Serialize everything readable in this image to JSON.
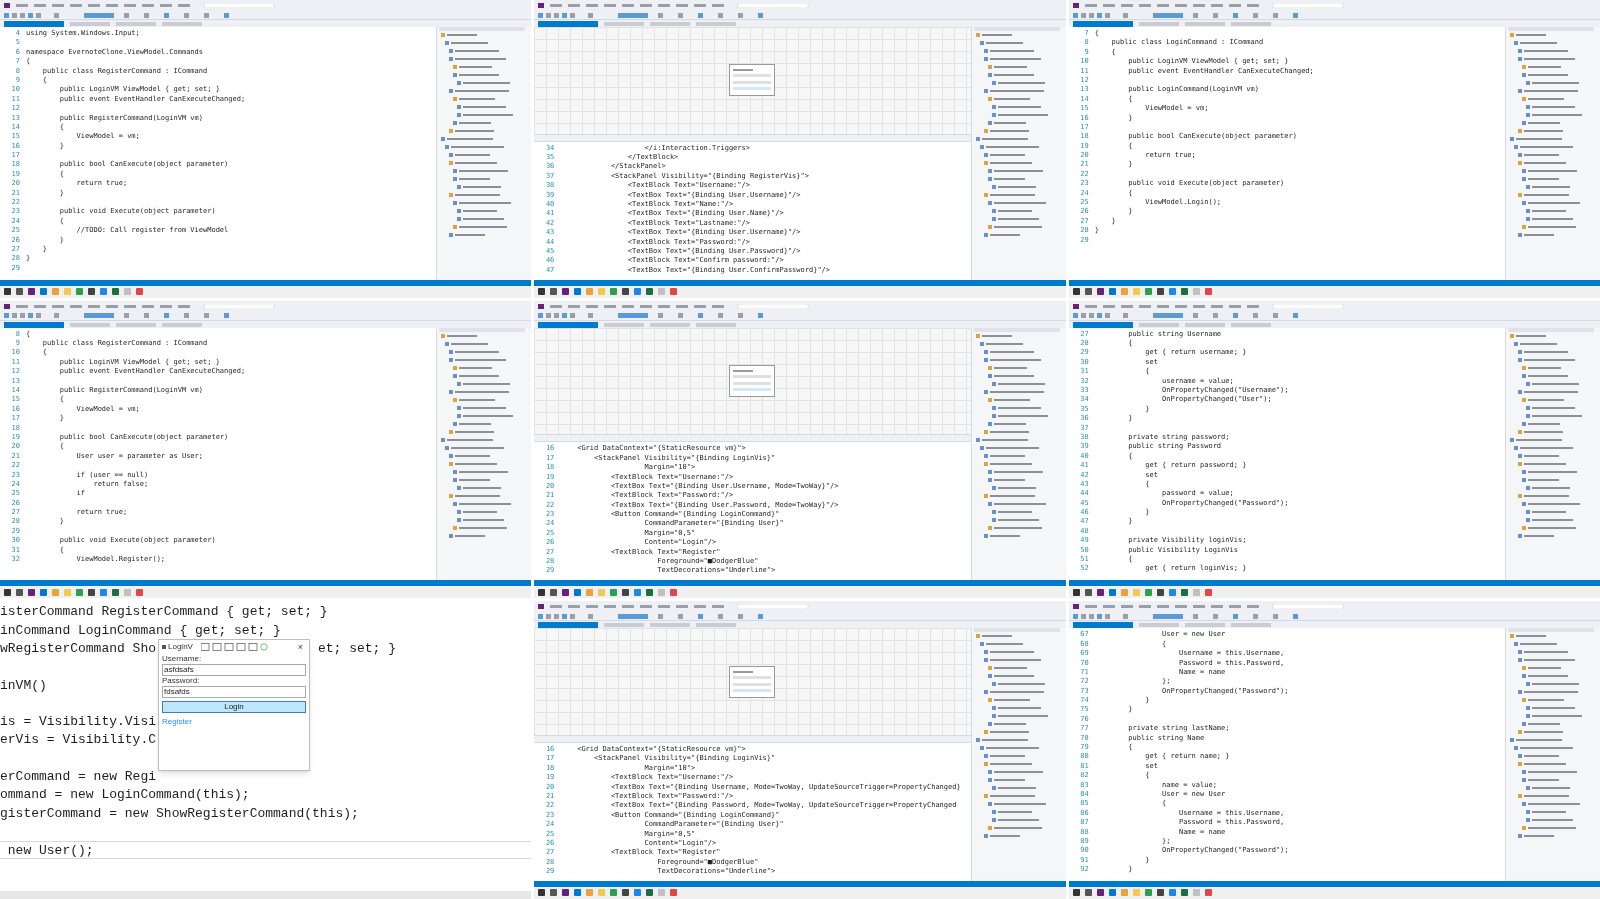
{
  "tiles": [
    {
      "kind": "code",
      "lines": [
        {
          "number": "4",
          "text": "using System.Windows.Input;"
        },
        {
          "number": "5"
        },
        {
          "number": "6",
          "text": "namespace EvernoteClone.ViewModel.Commands"
        },
        {
          "number": "7",
          "text": "{"
        },
        {
          "number": "8",
          "text": "    public class RegisterCommand : ICommand"
        },
        {
          "number": "9",
          "text": "    {"
        },
        {
          "number": "10",
          "text": "        public LoginVM ViewModel { get; set; }"
        },
        {
          "number": "11",
          "text": "        public event EventHandler CanExecuteChanged;"
        },
        {
          "number": "12"
        },
        {
          "number": "13",
          "text": "        public RegisterCommand(LoginVM vm)"
        },
        {
          "number": "14",
          "text": "        {"
        },
        {
          "number": "15",
          "text": "            ViewModel = vm;"
        },
        {
          "number": "16",
          "text": "        }"
        },
        {
          "number": "17"
        },
        {
          "number": "18",
          "text": "        public bool CanExecute(object parameter)"
        },
        {
          "number": "19",
          "text": "        {"
        },
        {
          "number": "20",
          "text": "            return true;"
        },
        {
          "number": "21",
          "text": "        }"
        },
        {
          "number": "22"
        },
        {
          "number": "23",
          "text": "        public void Execute(object parameter)"
        },
        {
          "number": "24",
          "text": "        {"
        },
        {
          "number": "25",
          "text": "            //TODO: Call register from ViewModel"
        },
        {
          "number": "26",
          "text": "        }"
        },
        {
          "number": "27",
          "text": "    }"
        },
        {
          "number": "28",
          "text": "}"
        },
        {
          "number": "29"
        }
      ]
    },
    {
      "kind": "xaml",
      "lines": [
        {
          "number": "34",
          "text": "                    </i:Interaction.Triggers>"
        },
        {
          "number": "35",
          "text": "                </TextBlock>"
        },
        {
          "number": "36",
          "text": "            </StackPanel>"
        },
        {
          "number": "37",
          "text": "            <StackPanel Visibility=\"{Binding RegisterVis}\">"
        },
        {
          "number": "38",
          "text": "                <TextBlock Text=\"Username:\"/>"
        },
        {
          "number": "39",
          "text": "                <TextBox Text=\"{Binding User.Username}\"/>"
        },
        {
          "number": "40",
          "text": "                <TextBlock Text=\"Name:\"/>"
        },
        {
          "number": "41",
          "text": "                <TextBox Text=\"{Binding User.Name}\"/>"
        },
        {
          "number": "42",
          "text": "                <TextBlock Text=\"Lastname:\"/>"
        },
        {
          "number": "43",
          "text": "                <TextBox Text=\"{Binding User.Username}\"/>"
        },
        {
          "number": "44",
          "text": "                <TextBlock Text=\"Password:\"/>"
        },
        {
          "number": "45",
          "text": "                <TextBox Text=\"{Binding User.Password}\"/>"
        },
        {
          "number": "46",
          "text": "                <TextBlock Text=\"Confirm password:\"/>"
        },
        {
          "number": "47",
          "text": "                <TextBox Text=\"{Binding User.ConfirmPassword}\"/>"
        }
      ]
    },
    {
      "kind": "code",
      "lines": [
        {
          "number": "7",
          "text": "{"
        },
        {
          "number": "8",
          "text": "    public class LoginCommand : ICommand"
        },
        {
          "number": "9",
          "text": "    {"
        },
        {
          "number": "10",
          "text": "        public LoginVM ViewModel { get; set; }"
        },
        {
          "number": "11",
          "text": "        public event EventHandler CanExecuteChanged;"
        },
        {
          "number": "12"
        },
        {
          "number": "13",
          "text": "        public LoginCommand(LoginVM vm)"
        },
        {
          "number": "14",
          "text": "        {"
        },
        {
          "number": "15",
          "text": "            ViewModel = vm;"
        },
        {
          "number": "16",
          "text": "        }"
        },
        {
          "number": "17"
        },
        {
          "number": "18",
          "text": "        public bool CanExecute(object parameter)"
        },
        {
          "number": "19",
          "text": "        {"
        },
        {
          "number": "20",
          "text": "            return true;"
        },
        {
          "number": "21",
          "text": "        }"
        },
        {
          "number": "22"
        },
        {
          "number": "23",
          "text": "        public void Execute(object parameter)"
        },
        {
          "number": "24",
          "text": "        {"
        },
        {
          "number": "25",
          "text": "            ViewModel.Login();"
        },
        {
          "number": "26",
          "text": "        }"
        },
        {
          "number": "27",
          "text": "    }"
        },
        {
          "number": "28",
          "text": "}"
        },
        {
          "number": "29"
        }
      ]
    },
    {
      "kind": "code",
      "lines": [
        {
          "number": "8",
          "text": "{"
        },
        {
          "number": "9",
          "text": "    public class RegisterCommand : ICommand"
        },
        {
          "number": "10",
          "text": "    {"
        },
        {
          "number": "11",
          "text": "        public LoginVM ViewModel { get; set; }"
        },
        {
          "number": "12",
          "text": "        public event EventHandler CanExecuteChanged;"
        },
        {
          "number": "13"
        },
        {
          "number": "14",
          "text": "        public RegisterCommand(LoginVM vm)"
        },
        {
          "number": "15",
          "text": "        {"
        },
        {
          "number": "16",
          "text": "            ViewModel = vm;"
        },
        {
          "number": "17",
          "text": "        }"
        },
        {
          "number": "18"
        },
        {
          "number": "19",
          "text": "        public bool CanExecute(object parameter)"
        },
        {
          "number": "20",
          "text": "        {"
        },
        {
          "number": "21",
          "text": "            User user = parameter as User;"
        },
        {
          "number": "22"
        },
        {
          "number": "23",
          "text": "            if (user == null)"
        },
        {
          "number": "24",
          "text": "                return false;"
        },
        {
          "number": "25",
          "text": "            if"
        },
        {
          "number": "26"
        },
        {
          "number": "27",
          "text": "            return true;"
        },
        {
          "number": "28",
          "text": "        }"
        },
        {
          "number": "29"
        },
        {
          "number": "30",
          "text": "        public void Execute(object parameter)"
        },
        {
          "number": "31",
          "text": "        {"
        },
        {
          "number": "32",
          "text": "            ViewModel.Register();"
        }
      ]
    },
    {
      "kind": "xaml",
      "lines": [
        {
          "number": "16",
          "text": "    <Grid DataContext=\"{StaticResource vm}\">"
        },
        {
          "number": "17",
          "text": "        <StackPanel Visibility=\"{Binding LoginVis}\""
        },
        {
          "number": "18",
          "text": "                    Margin=\"10\">"
        },
        {
          "number": "19",
          "text": "            <TextBlock Text=\"Username:\"/>"
        },
        {
          "number": "20",
          "text": "            <TextBox Text=\"{Binding User.Username, Mode=TwoWay}\"/>"
        },
        {
          "number": "21",
          "text": "            <TextBlock Text=\"Password:\"/>"
        },
        {
          "number": "22",
          "text": "            <TextBox Text=\"{Binding User.Password, Mode=TwoWay}\"/>"
        },
        {
          "number": "23",
          "text": "            <Button Command=\"{Binding LoginCommand}\""
        },
        {
          "number": "24",
          "text": "                    CommandParameter=\"{Binding User}\""
        },
        {
          "number": "25",
          "text": "                    Margin=\"0,5\""
        },
        {
          "number": "26",
          "text": "                    Content=\"Login\"/>"
        },
        {
          "number": "27",
          "text": "            <TextBlock Text=\"Register\""
        },
        {
          "number": "28",
          "text": "                       Foreground=\"■DodgerBlue\""
        },
        {
          "number": "29",
          "text": "                       TextDecorations=\"Underline\">"
        }
      ]
    },
    {
      "kind": "code",
      "lines": [
        {
          "number": "27",
          "text": "        public string Username"
        },
        {
          "number": "28",
          "text": "        {"
        },
        {
          "number": "29",
          "text": "            get { return username; }"
        },
        {
          "number": "30",
          "text": "            set"
        },
        {
          "number": "31",
          "text": "            {"
        },
        {
          "number": "32",
          "text": "                username = value;"
        },
        {
          "number": "33",
          "text": "                OnPropertyChanged(\"Username\");"
        },
        {
          "number": "34",
          "text": "                OnPropertyChanged(\"User\");"
        },
        {
          "number": "35",
          "text": "            }"
        },
        {
          "number": "36",
          "text": "        }"
        },
        {
          "number": "37"
        },
        {
          "number": "38",
          "text": "        private string password;"
        },
        {
          "number": "39",
          "text": "        public string Password"
        },
        {
          "number": "40",
          "text": "        {"
        },
        {
          "number": "41",
          "text": "            get { return password; }"
        },
        {
          "number": "42",
          "text": "            set"
        },
        {
          "number": "43",
          "text": "            {"
        },
        {
          "number": "44",
          "text": "                password = value;"
        },
        {
          "number": "45",
          "text": "                OnPropertyChanged(\"Password\");"
        },
        {
          "number": "46",
          "text": "            }"
        },
        {
          "number": "47",
          "text": "        }"
        },
        {
          "number": "48"
        },
        {
          "number": "49",
          "text": "        private Visibility loginVis;"
        },
        {
          "number": "50",
          "text": "        public Visibility LoginVis"
        },
        {
          "number": "51",
          "text": "        {"
        },
        {
          "number": "52",
          "text": "            get { return loginVis; }"
        }
      ]
    },
    {
      "kind": "zoomed",
      "lines": [
        {
          "text": "isterCommand RegisterCommand { get; set; }",
          "gap_before": false
        },
        {
          "text": "inCommand LoginCommand { get; set; }",
          "gap_before": false
        },
        {
          "text": "wRegisterCommand Sho",
          "after": "et; set; }",
          "gap_before": false
        },
        {
          "text": "inVM()",
          "gap_before": true
        },
        {
          "text": "is = Visibility.Visi",
          "gap_before": true
        },
        {
          "text": "erVis = Visibility.C",
          "gap_before": false
        },
        {
          "text": "erCommand = new Regi",
          "gap_before": true
        },
        {
          "text": "ommand = new LoginCommand(this);",
          "gap_before": false
        },
        {
          "text": "gisterCommand = new ShowRegisterCommand(this);",
          "gap_before": false
        },
        {
          "text": " new User();",
          "gap_before": true
        }
      ],
      "dialog": {
        "title": "LoginV",
        "close": "×",
        "fields": [
          {
            "label": "Username:",
            "value": "asfdsafs"
          },
          {
            "label": "Password:",
            "value": "fdsafds"
          }
        ],
        "button": "Login",
        "link": "Register"
      }
    },
    {
      "kind": "xaml",
      "lines": [
        {
          "number": "16",
          "text": "    <Grid DataContext=\"{StaticResource vm}\">"
        },
        {
          "number": "17",
          "text": "        <StackPanel Visibility=\"{Binding LoginVis}\""
        },
        {
          "number": "18",
          "text": "                    Margin=\"10\">"
        },
        {
          "number": "19",
          "text": "            <TextBlock Text=\"Username:\"/>"
        },
        {
          "number": "20",
          "text": "            <TextBox Text=\"{Binding Username, Mode=TwoWay, UpdateSourceTrigger=PropertyChanged}"
        },
        {
          "number": "21",
          "text": "            <TextBlock Text=\"Password:\"/>"
        },
        {
          "number": "22",
          "text": "            <TextBox Text=\"{Binding Password, Mode=TwoWay, UpdateSourceTrigger=PropertyChanged"
        },
        {
          "number": "23",
          "text": "            <Button Command=\"{Binding LoginCommand}\""
        },
        {
          "number": "24",
          "text": "                    CommandParameter=\"{Binding User}\""
        },
        {
          "number": "25",
          "text": "                    Margin=\"0,5\""
        },
        {
          "number": "26",
          "text": "                    Content=\"Login\"/>"
        },
        {
          "number": "27",
          "text": "            <TextBlock Text=\"Register\""
        },
        {
          "number": "28",
          "text": "                       Foreground=\"■DodgerBlue\""
        },
        {
          "number": "29",
          "text": "                       TextDecorations=\"Underline\">"
        }
      ]
    },
    {
      "kind": "code",
      "lines": [
        {
          "number": "67",
          "text": "                User = new User"
        },
        {
          "number": "68",
          "text": "                {"
        },
        {
          "number": "69",
          "text": "                    Username = this.Username,"
        },
        {
          "number": "70",
          "text": "                    Password = this.Password,"
        },
        {
          "number": "71",
          "text": "                    Name = name"
        },
        {
          "number": "72",
          "text": "                };"
        },
        {
          "number": "73",
          "text": "                OnPropertyChanged(\"Password\");"
        },
        {
          "number": "74",
          "text": "            }"
        },
        {
          "number": "75",
          "text": "        }"
        },
        {
          "number": "76"
        },
        {
          "number": "77",
          "text": "        private string lastName;"
        },
        {
          "number": "78",
          "text": "        public string Name"
        },
        {
          "number": "79",
          "text": "        {"
        },
        {
          "number": "80",
          "text": "            get { return name; }"
        },
        {
          "number": "81",
          "text": "            set"
        },
        {
          "number": "82",
          "text": "            {"
        },
        {
          "number": "83",
          "text": "                name = value;"
        },
        {
          "number": "84",
          "text": "                User = new User"
        },
        {
          "number": "85",
          "text": "                {"
        },
        {
          "number": "86",
          "text": "                    Username = this.Username,"
        },
        {
          "number": "87",
          "text": "                    Password = this.Password,"
        },
        {
          "number": "88",
          "text": "                    Name = name"
        },
        {
          "number": "89",
          "text": "                };"
        },
        {
          "number": "90",
          "text": "                OnPropertyChanged(\"Password\");"
        },
        {
          "number": "91",
          "text": "            }"
        },
        {
          "number": "92",
          "text": "        }"
        }
      ]
    }
  ]
}
